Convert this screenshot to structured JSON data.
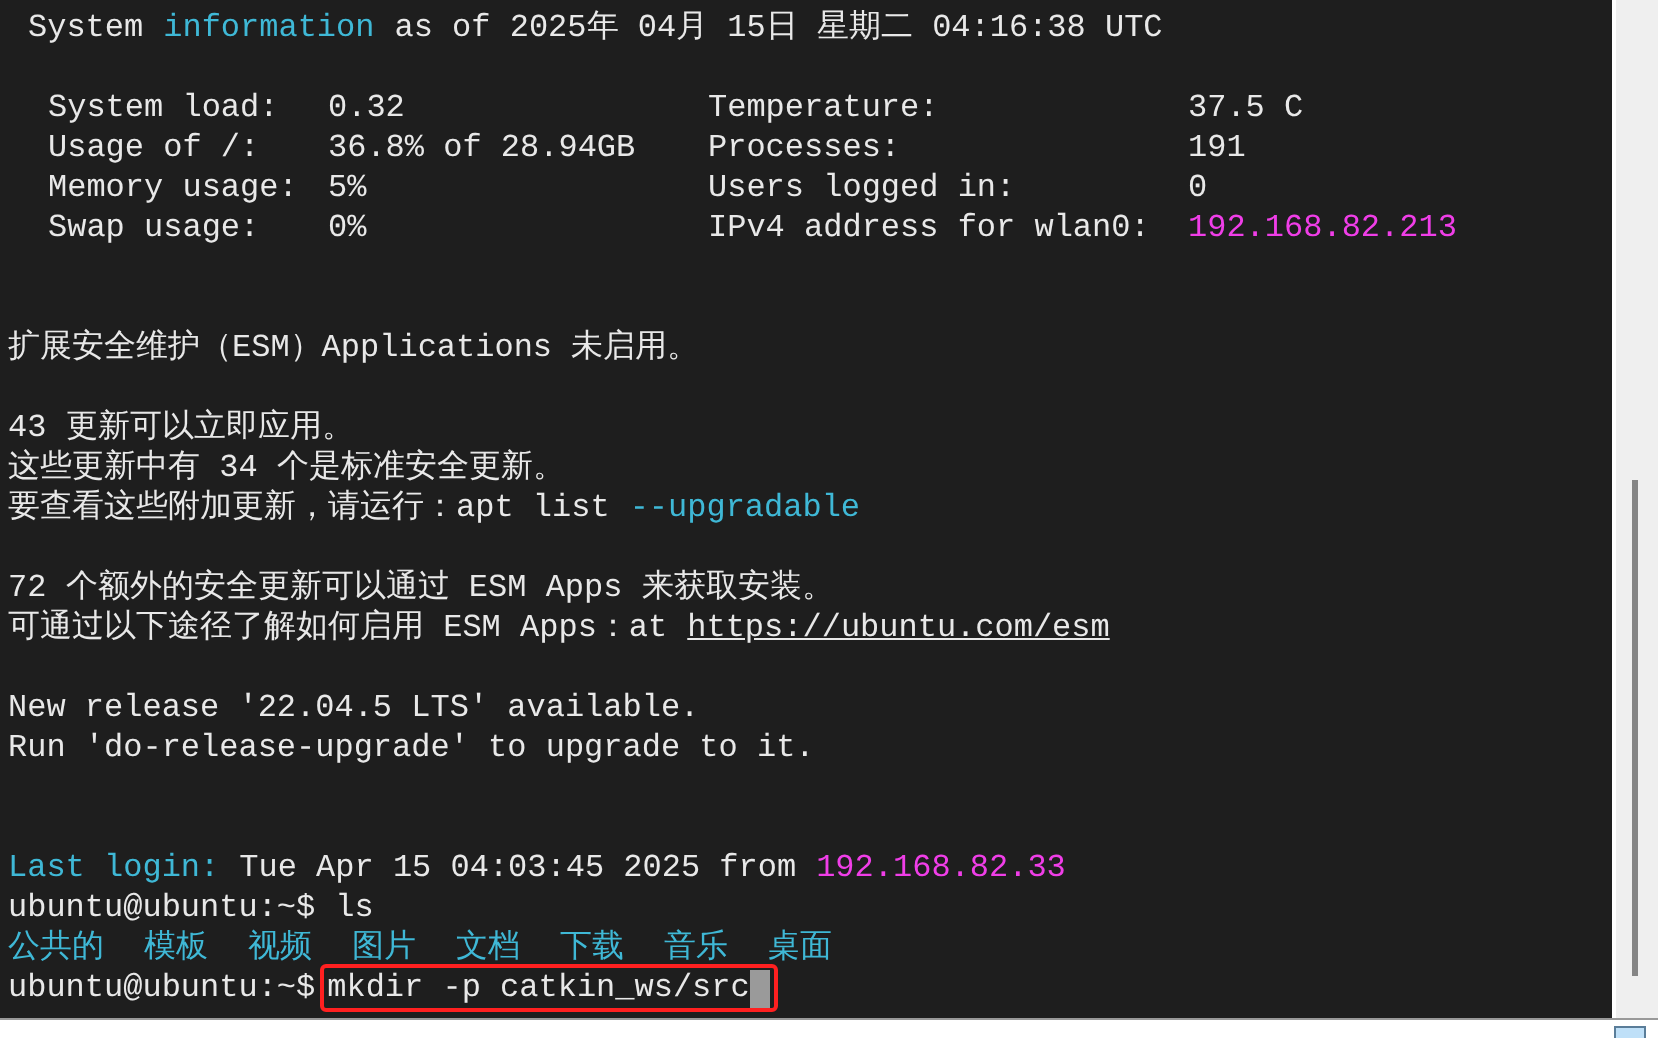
{
  "terminal": {
    "lines": [
      {
        "kind": "header",
        "segments": [
          {
            "text": "System",
            "kind": "plain"
          },
          {
            "text": "information",
            "kind": "keyword"
          },
          {
            "text": "as of 2025年 04月 15日 星期二 04:16:38 UTC",
            "kind": "plain"
          }
        ]
      },
      {
        "kind": "blank"
      },
      {
        "kind": "sysinfo",
        "rows": [
          {
            "label": "System load:",
            "value": "0.32",
            "label_2": "Temperature:",
            "value_2": "37.5 C",
            "kind": "plain"
          },
          {
            "label": "Usage of /:",
            "value": "36.8% of 28.94GB",
            "label_2": "Processes:",
            "value_2": "191",
            "kind": "plain"
          },
          {
            "label": "Memory usage:",
            "value": "5%",
            "label_2": "Users logged in:",
            "value_2": "0",
            "kind": "plain"
          },
          {
            "label": "Swap usage:",
            "value": "0%",
            "label_2": "IPv4 address for wlan0:",
            "value_2": "192.168.82.213",
            "kind": "address"
          }
        ]
      },
      {
        "kind": "blank"
      },
      {
        "kind": "blank"
      },
      {
        "kind": "text",
        "segments": [
          {
            "text": "扩展安全维护（ESM）Applications 未启用。",
            "kind": "plain"
          }
        ]
      },
      {
        "kind": "blank"
      },
      {
        "kind": "text",
        "segments": [
          {
            "text": "43 更新可以立即应用。",
            "kind": "plain"
          }
        ]
      },
      {
        "kind": "text",
        "segments": [
          {
            "text": "这些更新中有 34 个是标准安全更新。",
            "kind": "plain"
          }
        ]
      },
      {
        "kind": "text",
        "segments": [
          {
            "text": "要查看这些附加更新，请运行：apt list",
            "kind": "plain"
          },
          {
            "text": "--upgradable",
            "kind": "keyword"
          }
        ]
      },
      {
        "kind": "blank"
      },
      {
        "kind": "text",
        "segments": [
          {
            "text": "72 个额外的安全更新可以通过 ESM Apps 来获取安装。",
            "kind": "plain"
          }
        ]
      },
      {
        "kind": "text",
        "segments": [
          {
            "text": "可通过以下途径了解如何启用 ESM Apps：at",
            "kind": "plain"
          },
          {
            "text": "https://ubuntu.com/esm",
            "kind": "link"
          }
        ]
      },
      {
        "kind": "blank"
      },
      {
        "kind": "text",
        "segments": [
          {
            "text": "New release '22.04.5 LTS' available.",
            "kind": "plain"
          }
        ]
      },
      {
        "kind": "text",
        "segments": [
          {
            "text": "Run 'do-release-upgrade' to upgrade to it.",
            "kind": "plain"
          }
        ]
      },
      {
        "kind": "blank"
      },
      {
        "kind": "blank"
      },
      {
        "kind": "text",
        "segments": [
          {
            "text": "Last login:",
            "kind": "keyword"
          },
          {
            "text": "Tue Apr 15 04:03:45 2025 from",
            "kind": "plain"
          },
          {
            "text": "192.168.82.33",
            "kind": "address"
          }
        ]
      },
      {
        "kind": "prompt",
        "prompt": "ubuntu@ubuntu:~$",
        "command": "ls",
        "highlighted": false,
        "cursor": false
      },
      {
        "kind": "listing",
        "items": [
          "公共的",
          "模板",
          "视频",
          "图片",
          "文档",
          "下载",
          "音乐",
          "桌面"
        ]
      },
      {
        "kind": "prompt",
        "prompt": "ubuntu@ubuntu:~$",
        "command": "mkdir -p catkin_ws/src",
        "highlighted": true,
        "cursor": true
      }
    ]
  }
}
